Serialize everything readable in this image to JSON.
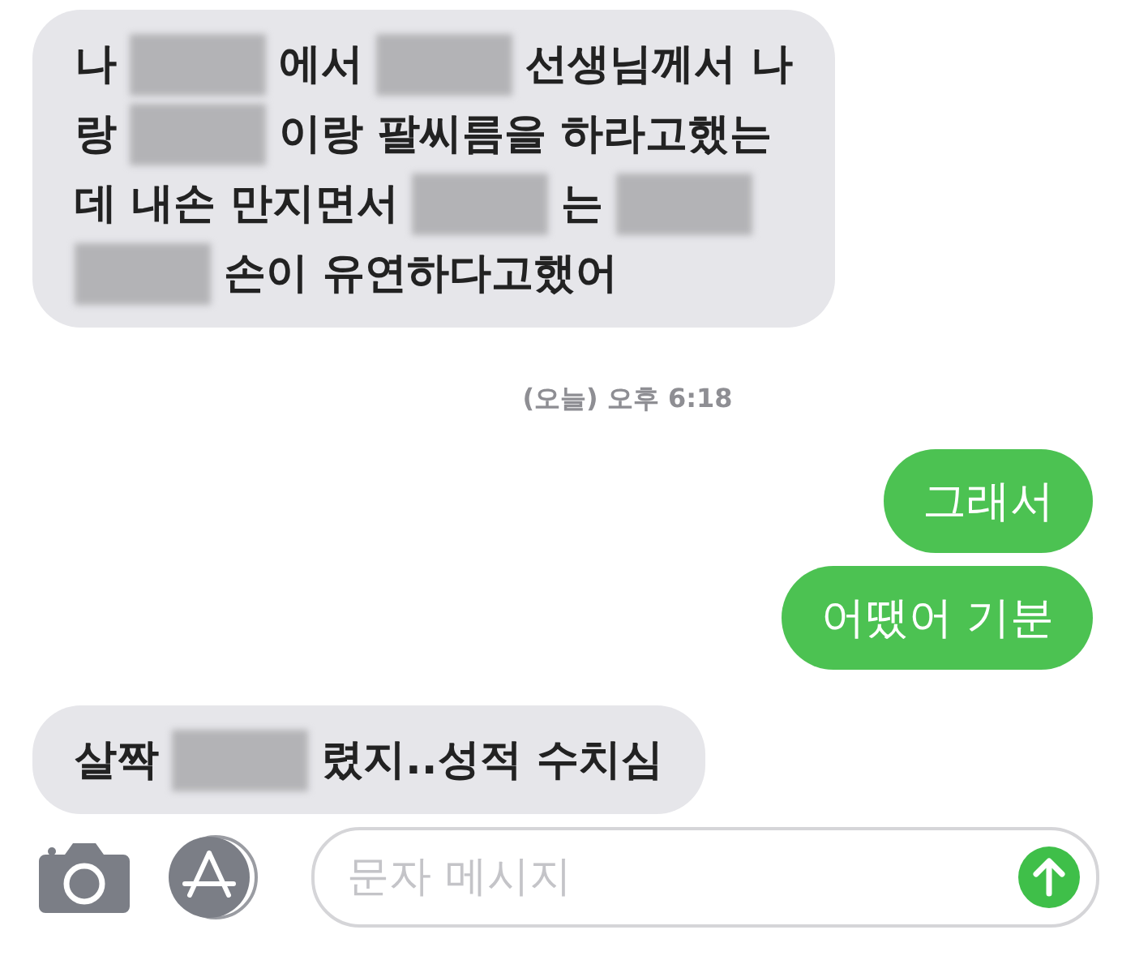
{
  "messages": [
    {
      "kind": "incoming",
      "lines": [
        [
          {
            "kind": "text",
            "text": "나"
          },
          {
            "kind": "redacted"
          },
          {
            "kind": "text",
            "text": "에서"
          },
          {
            "kind": "redacted"
          },
          {
            "kind": "text",
            "text": "선생님께서 나"
          }
        ],
        [
          {
            "kind": "text",
            "text": "랑"
          },
          {
            "kind": "redacted"
          },
          {
            "kind": "text",
            "text": "이랑 팔씨름을 하라고했는"
          }
        ],
        [
          {
            "kind": "text",
            "text": "데 내손 만지면서"
          },
          {
            "kind": "redacted"
          },
          {
            "kind": "text",
            "text": "는"
          },
          {
            "kind": "redacted"
          }
        ],
        [
          {
            "kind": "redacted"
          },
          {
            "kind": "text",
            "text": "손이 유연하다고했어"
          }
        ]
      ]
    },
    {
      "kind": "timestamp",
      "text": "(오늘) 오후 6:18"
    },
    {
      "kind": "outgoing",
      "text": "그래서"
    },
    {
      "kind": "outgoing",
      "text": "어땠어 기분"
    },
    {
      "kind": "incoming",
      "lines": [
        [
          {
            "kind": "text",
            "text": "살짝"
          },
          {
            "kind": "redacted"
          },
          {
            "kind": "text",
            "text": "렸지..성적 수치심"
          }
        ]
      ]
    }
  ],
  "composer": {
    "placeholder": "문자 메시지"
  }
}
